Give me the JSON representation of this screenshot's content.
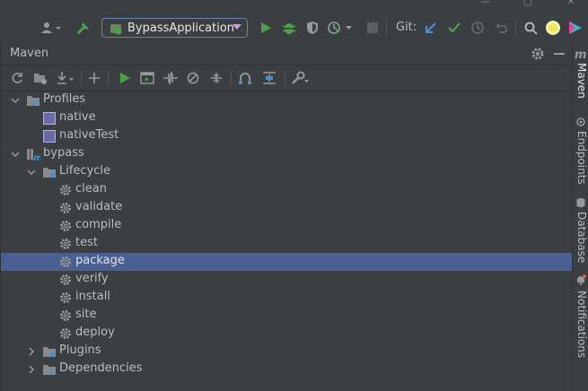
{
  "toolbar": {
    "run_config": "BypassApplication",
    "git_label": "Git:"
  },
  "maven": {
    "title": "Maven",
    "tree": [
      {
        "label": "Profiles",
        "level": 0,
        "expanded": true,
        "icon": "profiles-icon"
      },
      {
        "label": "native",
        "level": 1,
        "icon": "checkbox-icon"
      },
      {
        "label": "nativeTest",
        "level": 1,
        "icon": "checkbox-icon"
      },
      {
        "label": "bypass",
        "level": 0,
        "expanded": true,
        "icon": "maven-project-icon"
      },
      {
        "label": "Lifecycle",
        "level": 1,
        "expanded": true,
        "icon": "lifecycle-folder-icon"
      },
      {
        "label": "clean",
        "level": 2,
        "icon": "gear-icon"
      },
      {
        "label": "validate",
        "level": 2,
        "icon": "gear-icon"
      },
      {
        "label": "compile",
        "level": 2,
        "icon": "gear-icon"
      },
      {
        "label": "test",
        "level": 2,
        "icon": "gear-icon"
      },
      {
        "label": "package",
        "level": 2,
        "icon": "gear-icon",
        "selected": true
      },
      {
        "label": "verify",
        "level": 2,
        "icon": "gear-icon"
      },
      {
        "label": "install",
        "level": 2,
        "icon": "gear-icon"
      },
      {
        "label": "site",
        "level": 2,
        "icon": "gear-icon"
      },
      {
        "label": "deploy",
        "level": 2,
        "icon": "gear-icon"
      },
      {
        "label": "Plugins",
        "level": 1,
        "expanded": false,
        "icon": "plugins-folder-icon"
      },
      {
        "label": "Dependencies",
        "level": 1,
        "expanded": false,
        "icon": "dependencies-folder-icon"
      }
    ]
  },
  "right_stripe": {
    "maven_tab": "Maven",
    "endpoints_tab": "Endpoints",
    "database_tab": "Database",
    "notifications_tab": "Notifications"
  },
  "colors": {
    "background": "#3c3f41",
    "selection": "#4b5f93",
    "run_green": "#4ca14c",
    "accent_purple": "#c5a3e6"
  }
}
